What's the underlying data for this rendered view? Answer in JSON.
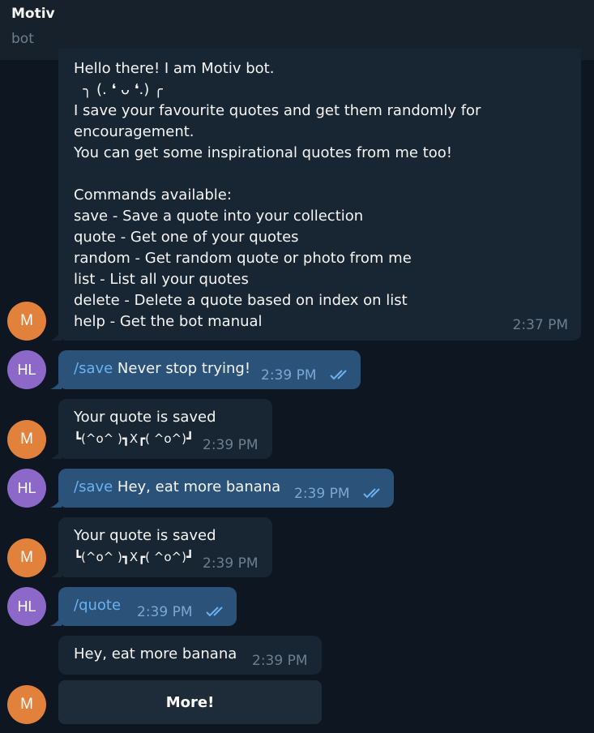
{
  "header": {
    "title": "Motiv",
    "subtitle": "bot"
  },
  "avatars": {
    "bot": "M",
    "user": "HL"
  },
  "messages": {
    "welcome": {
      "lines": [
        "Hello there! I am Motiv bot.",
        "  ╮ (. ❛ ᴗ ❛.) ╭",
        "I save your favourite quotes and get them randomly for",
        "encouragement.",
        "You can get some inspirational quotes from me too!",
        "",
        "Commands available:",
        "save - Save a quote into your collection",
        "quote - Get one of your quotes",
        "random - Get random quote or photo from me",
        "list - List all your quotes",
        "delete - Delete a quote based on index on list",
        "help - Get the bot manual"
      ],
      "time": "2:37 PM"
    },
    "save1": {
      "command": "/save",
      "text": " Never stop trying!",
      "time": "2:39 PM"
    },
    "reply1": {
      "line1": "Your quote is saved",
      "line2": "┗(^o^ )┓X┏( ^o^)┛",
      "time": "2:39 PM"
    },
    "save2": {
      "command": "/save",
      "text": " Hey, eat more banana",
      "time": "2:39 PM"
    },
    "reply2": {
      "line1": "Your quote is saved",
      "line2": "┗(^o^ )┓X┏( ^o^)┛",
      "time": "2:39 PM"
    },
    "quote_cmd": {
      "command": "/quote",
      "time": "2:39 PM"
    },
    "quote_reply": {
      "text": "Hey, eat more banana",
      "time": "2:39 PM"
    }
  },
  "more_button": {
    "label": "More!"
  }
}
